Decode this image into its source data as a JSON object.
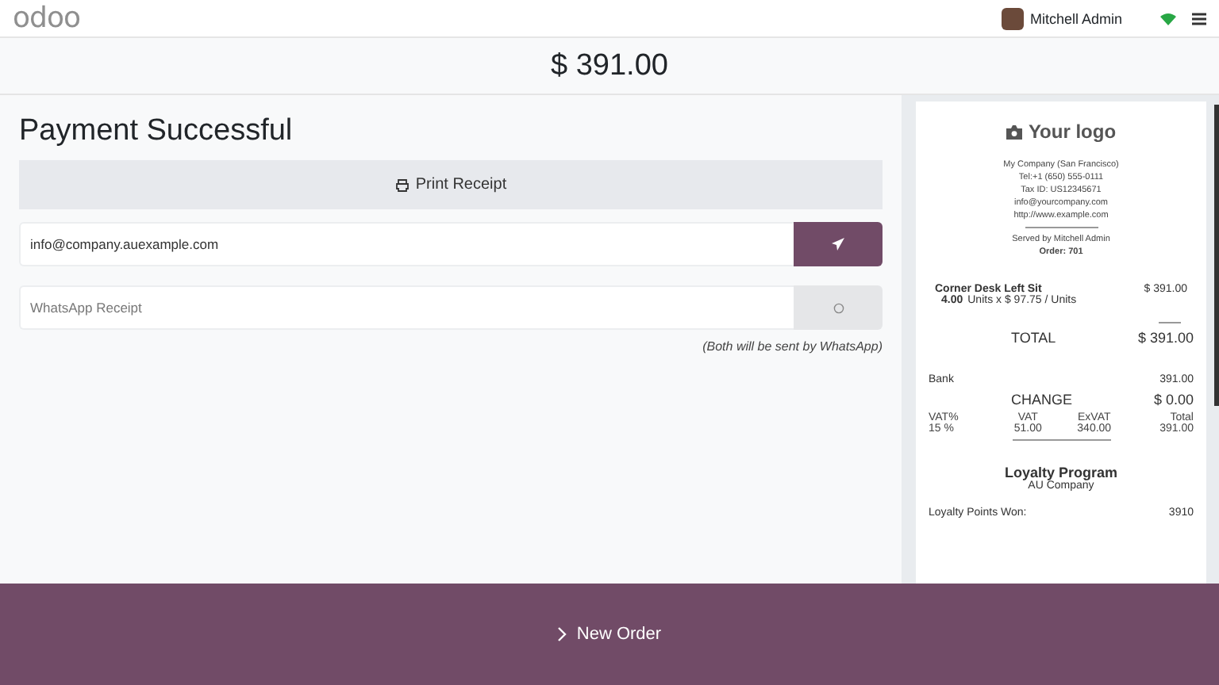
{
  "header": {
    "logo": "odoo",
    "user": "Mitchell Admin"
  },
  "amount": "$ 391.00",
  "title": "Payment Successful",
  "print_button": "Print Receipt",
  "email_field": {
    "value": "info@company.auexample.com"
  },
  "whatsapp_field": {
    "placeholder": "WhatsApp Receipt"
  },
  "note": "(Both will be sent by WhatsApp)",
  "receipt": {
    "logo": "Your logo",
    "company_lines": [
      "My Company (San Francisco)",
      "Tel:+1 (650) 555-0111",
      "Tax ID: US12345671",
      "info@yourcompany.com",
      "http://www.example.com"
    ],
    "served_by": "Served by Mitchell Admin",
    "order": "Order: 701",
    "lines": [
      {
        "product": "Corner Desk Left Sit",
        "price": "$ 391.00",
        "qty": "4.00",
        "detail": "Units x $ 97.75 / Units"
      }
    ],
    "total_label": "TOTAL",
    "total": "$ 391.00",
    "payments": [
      {
        "method": "Bank",
        "amount": "391.00"
      }
    ],
    "change_label": "CHANGE",
    "change": "$ 0.00",
    "tax_columns": [
      "VAT%",
      "VAT",
      "ExVAT",
      "Total"
    ],
    "tax_rows": [
      [
        "15 %",
        "51.00",
        "340.00",
        "391.00"
      ]
    ],
    "loyalty_title": "Loyalty Program",
    "loyalty_company": "AU Company",
    "loyalty_rows": [
      {
        "label": "Loyalty Points Won:",
        "value": "3910"
      }
    ]
  },
  "footer_button": "New Order"
}
